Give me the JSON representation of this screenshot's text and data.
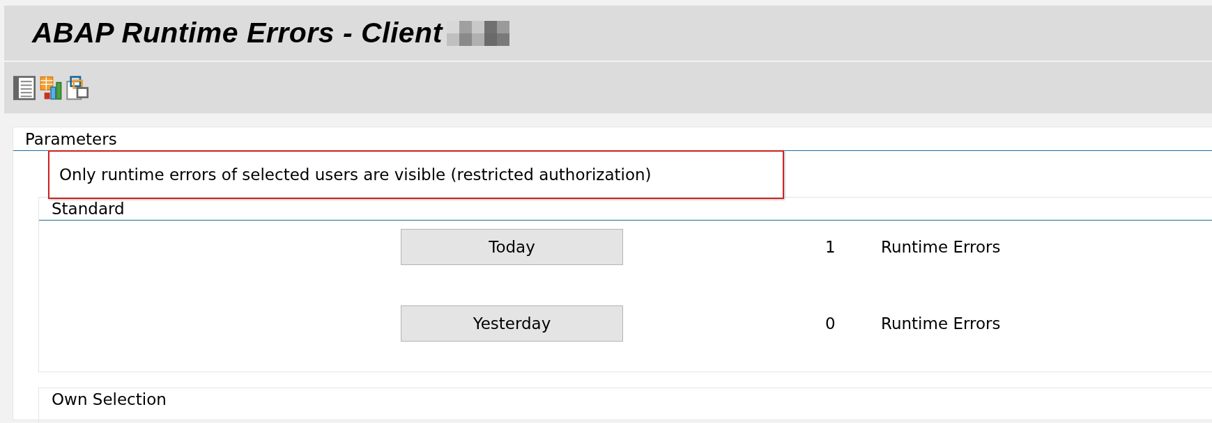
{
  "window": {
    "title": "ABAP Runtime Errors - Client",
    "client_redacted": true
  },
  "toolbar": {
    "buttons": [
      {
        "kind": "list"
      },
      {
        "kind": "chart"
      },
      {
        "kind": "windows"
      }
    ]
  },
  "parameters": {
    "title": "Parameters",
    "notice": "Only runtime errors of selected users are visible (restricted authorization)",
    "standard": {
      "title": "Standard",
      "rows": [
        {
          "button": "Today",
          "count": "1",
          "unit": "Runtime Errors"
        },
        {
          "button": "Yesterday",
          "count": "0",
          "unit": "Runtime Errors"
        }
      ]
    },
    "own_selection": {
      "title": "Own Selection"
    }
  }
}
